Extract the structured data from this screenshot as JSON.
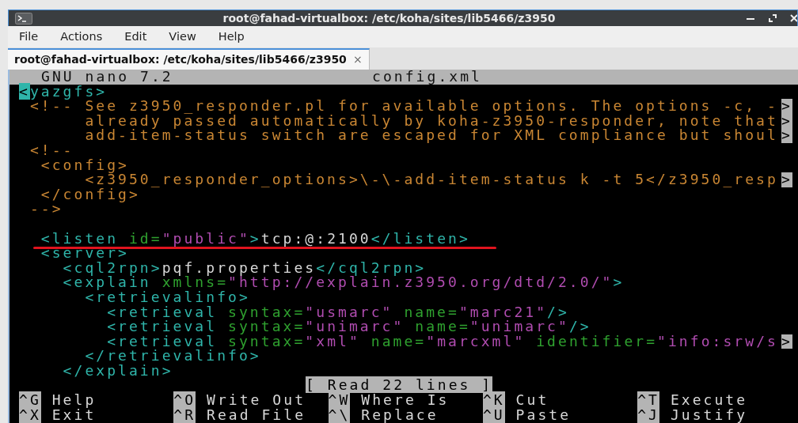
{
  "window": {
    "title": "root@fahad-virtualbox: /etc/koha/sites/lib5466/z3950"
  },
  "menu": [
    "File",
    "Actions",
    "Edit",
    "View",
    "Help"
  ],
  "tabs": [
    {
      "label": "root@fahad-virtualbox: /etc/koha/sites/lib5466/z3950",
      "selected": true,
      "close": "×"
    }
  ],
  "nano": {
    "version": "GNU nano 7.2",
    "filename": "config.xml",
    "lines": [
      {
        "underlined": false,
        "cut": false,
        "segments": [
          {
            "kind": "cursor",
            "text": "<"
          },
          {
            "kind": "tag",
            "text": "yazgfs>"
          }
        ]
      },
      {
        "underlined": false,
        "cut": true,
        "segments": [
          {
            "kind": "comment",
            "text": " <!-- See z3950_responder.pl for available options. The options -c, -"
          }
        ]
      },
      {
        "underlined": false,
        "cut": true,
        "segments": [
          {
            "kind": "comment",
            "text": "      already passed automatically by koha-z3950-responder, note that"
          }
        ]
      },
      {
        "underlined": false,
        "cut": true,
        "segments": [
          {
            "kind": "comment",
            "text": "      add-item-status switch are escaped for XML compliance but shoul"
          }
        ]
      },
      {
        "underlined": false,
        "cut": false,
        "segments": [
          {
            "kind": "comment",
            "text": " <!--"
          }
        ]
      },
      {
        "underlined": false,
        "cut": false,
        "segments": [
          {
            "kind": "comment",
            "text": "  <config>"
          }
        ]
      },
      {
        "underlined": false,
        "cut": true,
        "segments": [
          {
            "kind": "comment",
            "text": "      <z3950_responder_options>\\-\\-add-item-status k -t 5</z3950_resp"
          }
        ]
      },
      {
        "underlined": false,
        "cut": false,
        "segments": [
          {
            "kind": "comment",
            "text": "  </config>"
          }
        ]
      },
      {
        "underlined": false,
        "cut": false,
        "segments": [
          {
            "kind": "comment",
            "text": " -->"
          }
        ]
      },
      {
        "underlined": false,
        "cut": false
      },
      {
        "underlined": true,
        "cut": false,
        "segments": [
          {
            "kind": "tag",
            "text": "  <listen"
          },
          {
            "kind": "attr",
            "text": " id="
          },
          {
            "kind": "string",
            "text": "\"public\""
          },
          {
            "kind": "tag",
            "text": ">"
          },
          {
            "kind": "text",
            "text": "tcp:@:2100"
          },
          {
            "kind": "tag",
            "text": "</listen>"
          }
        ]
      },
      {
        "underlined": false,
        "cut": false,
        "segments": [
          {
            "kind": "tag",
            "text": "  <server>"
          }
        ]
      },
      {
        "underlined": false,
        "cut": false,
        "segments": [
          {
            "kind": "tag",
            "text": "    <cql2rpn>"
          },
          {
            "kind": "text",
            "text": "pqf.properties"
          },
          {
            "kind": "tag",
            "text": "</cql2rpn>"
          }
        ]
      },
      {
        "underlined": false,
        "cut": false,
        "segments": [
          {
            "kind": "tag",
            "text": "    <explain"
          },
          {
            "kind": "attr",
            "text": " xmlns="
          },
          {
            "kind": "string",
            "text": "\"http://explain.z3950.org/dtd/2.0/\""
          },
          {
            "kind": "tag",
            "text": ">"
          }
        ]
      },
      {
        "underlined": false,
        "cut": false,
        "segments": [
          {
            "kind": "tag",
            "text": "      <retrievalinfo>"
          }
        ]
      },
      {
        "underlined": false,
        "cut": false,
        "segments": [
          {
            "kind": "tag",
            "text": "        <retrieval"
          },
          {
            "kind": "attr",
            "text": " syntax="
          },
          {
            "kind": "string",
            "text": "\"usmarc\""
          },
          {
            "kind": "attr",
            "text": " name="
          },
          {
            "kind": "string",
            "text": "\"marc21\""
          },
          {
            "kind": "tag",
            "text": "/>"
          }
        ]
      },
      {
        "underlined": false,
        "cut": false,
        "segments": [
          {
            "kind": "tag",
            "text": "        <retrieval"
          },
          {
            "kind": "attr",
            "text": " syntax="
          },
          {
            "kind": "string",
            "text": "\"unimarc\""
          },
          {
            "kind": "attr",
            "text": " name="
          },
          {
            "kind": "string",
            "text": "\"unimarc\""
          },
          {
            "kind": "tag",
            "text": "/>"
          }
        ]
      },
      {
        "underlined": false,
        "cut": true,
        "segments": [
          {
            "kind": "tag",
            "text": "        <retrieval"
          },
          {
            "kind": "attr",
            "text": " syntax="
          },
          {
            "kind": "string",
            "text": "\"xml\""
          },
          {
            "kind": "attr",
            "text": " name="
          },
          {
            "kind": "string",
            "text": "\"marcxml\""
          },
          {
            "kind": "attr",
            "text": " identifier="
          },
          {
            "kind": "string",
            "text": "\"info:srw/s"
          }
        ]
      },
      {
        "underlined": false,
        "cut": false,
        "segments": [
          {
            "kind": "tag",
            "text": "      </retrievalinfo>"
          }
        ]
      },
      {
        "underlined": false,
        "cut": false,
        "segments": [
          {
            "kind": "tag",
            "text": "    </explain>"
          }
        ]
      }
    ],
    "cut_marker": ">",
    "status": "[ Read 22 lines ]",
    "shortcuts": [
      [
        {
          "key": "^G",
          "label": "Help"
        },
        {
          "key": "^O",
          "label": "Write Out"
        },
        {
          "key": "^W",
          "label": "Where Is"
        },
        {
          "key": "^K",
          "label": "Cut"
        },
        {
          "key": "^T",
          "label": "Execute"
        }
      ],
      [
        {
          "key": "^X",
          "label": "Exit"
        },
        {
          "key": "^R",
          "label": "Read File"
        },
        {
          "key": "^\\",
          "label": "Replace"
        },
        {
          "key": "^U",
          "label": "Paste"
        },
        {
          "key": "^J",
          "label": "Justify"
        }
      ]
    ]
  }
}
